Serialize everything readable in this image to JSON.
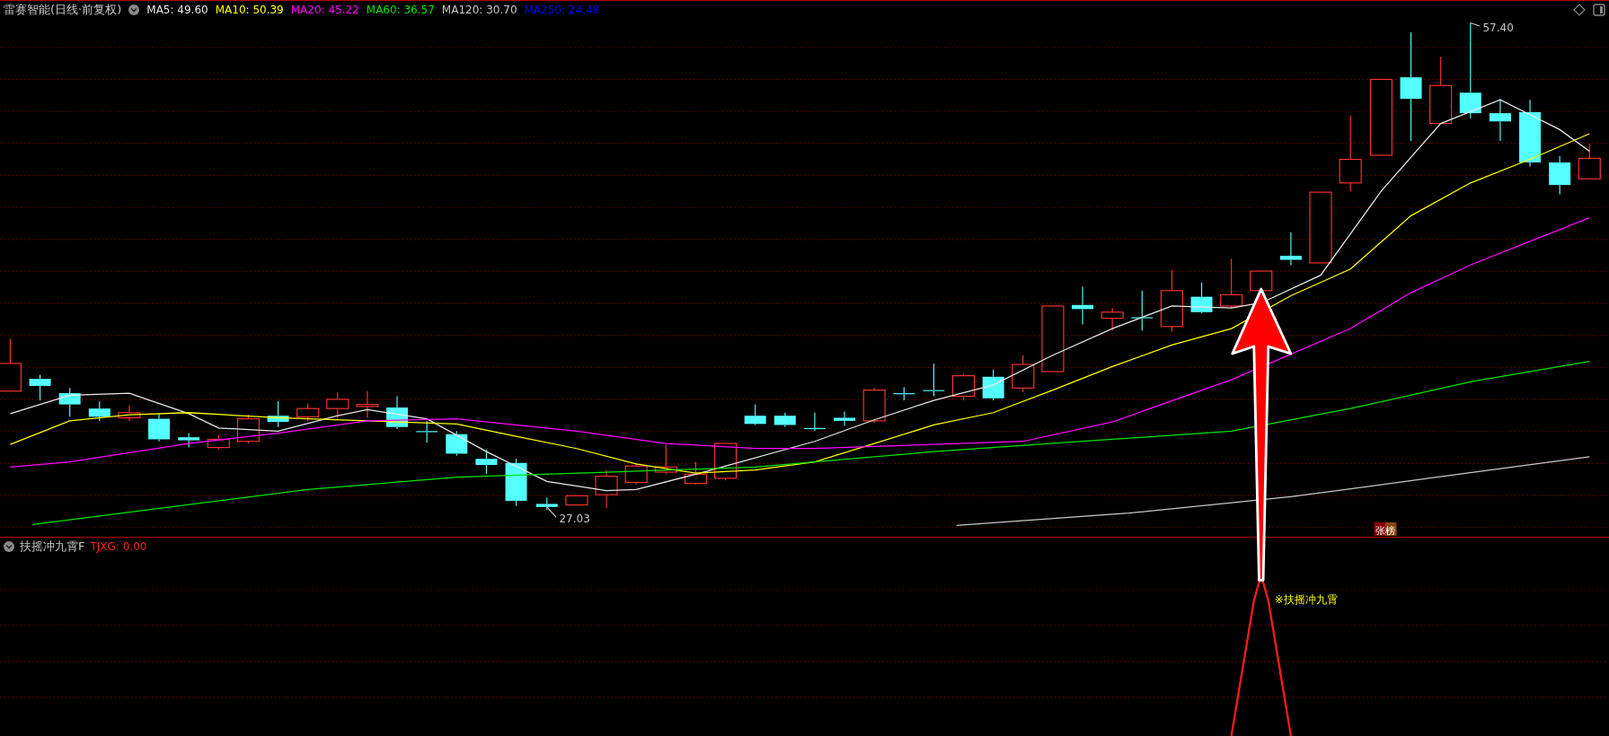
{
  "title": {
    "name": "雷赛智能(日线·前复权)"
  },
  "ma_legend": [
    {
      "label": "MA5: 49.60",
      "color": "#e8e8e8"
    },
    {
      "label": "MA10: 50.39",
      "color": "#ffff00"
    },
    {
      "label": "MA20: 45.22",
      "color": "#ff00ff"
    },
    {
      "label": "MA60: 36.57",
      "color": "#00e600"
    },
    {
      "label": "MA120: 30.70",
      "color": "#c8c8c8"
    },
    {
      "label": "MA250: 24.48",
      "color": "#0000ff"
    }
  ],
  "price_labels": [
    {
      "kind": "high",
      "text": "57.40"
    },
    {
      "kind": "low",
      "text": "27.03"
    }
  ],
  "badge": {
    "text": "张榜"
  },
  "indicator": {
    "name": "扶摇冲九霄F",
    "reading": "TJXG: 0.00",
    "signal_label": "※扶摇冲九霄"
  }
}
